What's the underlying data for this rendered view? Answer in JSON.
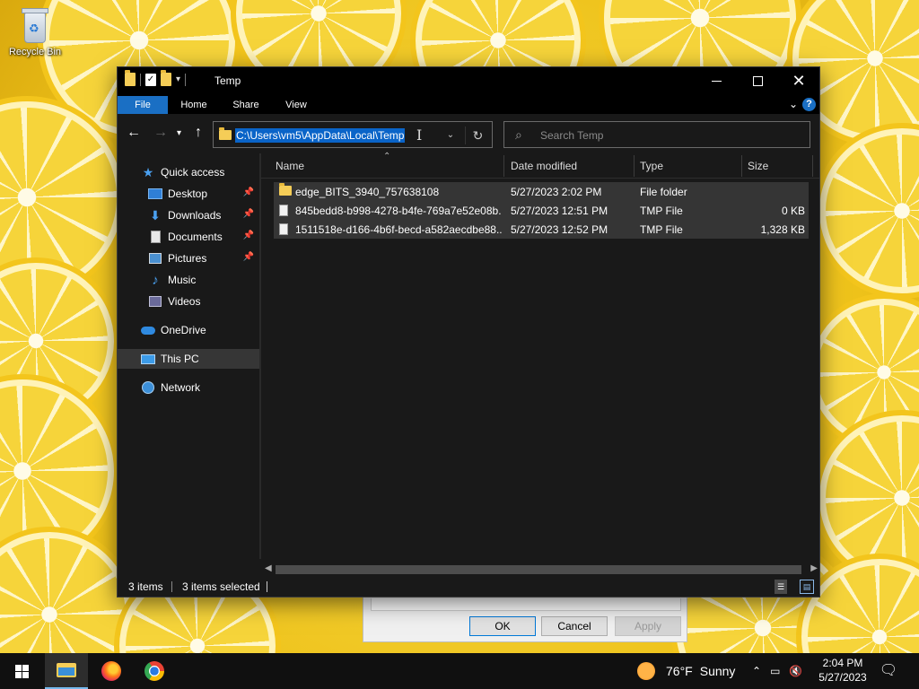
{
  "desktop": {
    "recycle_bin_label": "Recycle Bin"
  },
  "background_dialog": {
    "ok_label": "OK",
    "cancel_label": "Cancel",
    "apply_label": "Apply"
  },
  "window": {
    "title": "Temp",
    "ribbon_tabs": [
      "File",
      "Home",
      "Share",
      "View"
    ],
    "address_path": "C:\\Users\\vm5\\AppData\\Local\\Temp",
    "search_placeholder": "Search Temp",
    "accent_color": "#1a6fc4"
  },
  "navigation": {
    "items": [
      {
        "label": "Quick access",
        "icon": "star-icon"
      },
      {
        "label": "Desktop",
        "icon": "desktop-icon",
        "pinned": true
      },
      {
        "label": "Downloads",
        "icon": "download-icon",
        "pinned": true
      },
      {
        "label": "Documents",
        "icon": "documents-icon",
        "pinned": true
      },
      {
        "label": "Pictures",
        "icon": "pictures-icon",
        "pinned": true
      },
      {
        "label": "Music",
        "icon": "music-icon"
      },
      {
        "label": "Videos",
        "icon": "videos-icon"
      },
      {
        "label": "OneDrive",
        "icon": "onedrive-icon"
      },
      {
        "label": "This PC",
        "icon": "this-pc-icon",
        "selected": true
      },
      {
        "label": "Network",
        "icon": "network-icon"
      }
    ]
  },
  "file_list": {
    "columns": [
      "Name",
      "Date modified",
      "Type",
      "Size"
    ],
    "rows": [
      {
        "name": "edge_BITS_3940_757638108",
        "date": "5/27/2023 2:02 PM",
        "type": "File folder",
        "size": "",
        "icon": "folder-icon"
      },
      {
        "name": "845bedd8-b998-4278-b4fe-769a7e52e08b...",
        "date": "5/27/2023 12:51 PM",
        "type": "TMP File",
        "size": "0 KB",
        "icon": "file-icon"
      },
      {
        "name": "1511518e-d166-4b6f-becd-a582aecdbe88...",
        "date": "5/27/2023 12:52 PM",
        "type": "TMP File",
        "size": "1,328 KB",
        "icon": "file-icon"
      }
    ]
  },
  "status": {
    "item_count": "3 items",
    "selected_count": "3 items selected"
  },
  "taskbar": {
    "weather_temp": "76°F",
    "weather_desc": "Sunny",
    "time": "2:04 PM",
    "date": "5/27/2023"
  }
}
